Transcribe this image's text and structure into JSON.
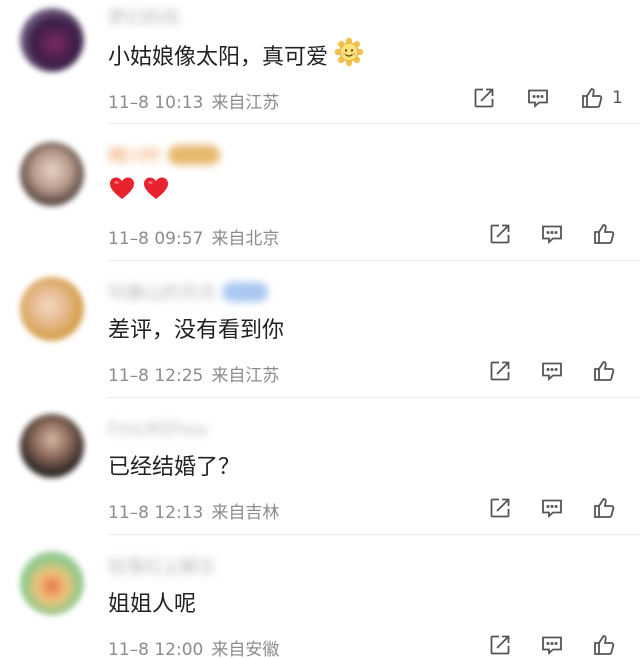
{
  "comments": [
    {
      "user": "梦幻的风",
      "text": "小姑娘像太阳，真可爱",
      "emoji": "sun-face-emoji",
      "date": "11–8 10:13",
      "location": "来自江苏",
      "likes": "1"
    },
    {
      "user": "晴川叶",
      "text": "",
      "emoji": "red-heart-emoji x2",
      "date": "11–8 09:57",
      "location": "来自北京",
      "likes": ""
    },
    {
      "user": "玲静山的月月",
      "text": "差评，没有看到你",
      "date": "11–8 12:25",
      "location": "来自江苏",
      "likes": ""
    },
    {
      "user": "FmLMZhou",
      "text": "已经结婚了？",
      "date": "11–8 12:13",
      "location": "来自吉林",
      "likes": ""
    },
    {
      "user": "轻落红尘解忘",
      "text": "姐姐人呢",
      "date": "11–8 12:00",
      "location": "来自安徽",
      "likes": ""
    }
  ],
  "icons": {
    "share": "share-icon",
    "reply": "reply-icon",
    "like": "like-icon"
  },
  "colors": {
    "text": "#222222",
    "meta": "#8c8c8c",
    "icon": "#555555",
    "heart": "#e8232f"
  }
}
